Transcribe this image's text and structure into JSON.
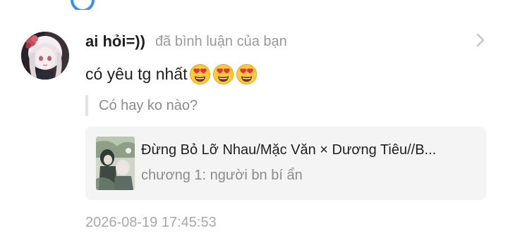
{
  "notification": {
    "username": "ai hỏi=))",
    "action_text": "đã bình luận của bạn",
    "comment_text": "có yêu tg nhất",
    "comment_emojis": [
      "smiling-face-with-heart-eyes",
      "smiling-face-with-heart-eyes",
      "smiling-face-with-heart-eyes"
    ],
    "quoted_text": "Có hay ko nào?",
    "story": {
      "title": "Đừng Bỏ Lỡ Nhau/Mặc Văn × Dương Tiêu//B...",
      "chapter": "chương 1: người bn bí ẩn"
    },
    "timestamp": "2026-08-19 17:45:53"
  },
  "icons": {
    "loading": "loading-spinner-icon",
    "chevron": "chevron-right-icon"
  },
  "colors": {
    "accent": "#3b8fe8",
    "muted_text": "#9a9a9a",
    "card_bg": "#f4f4f4",
    "quote_bar": "#e4e4e4"
  }
}
